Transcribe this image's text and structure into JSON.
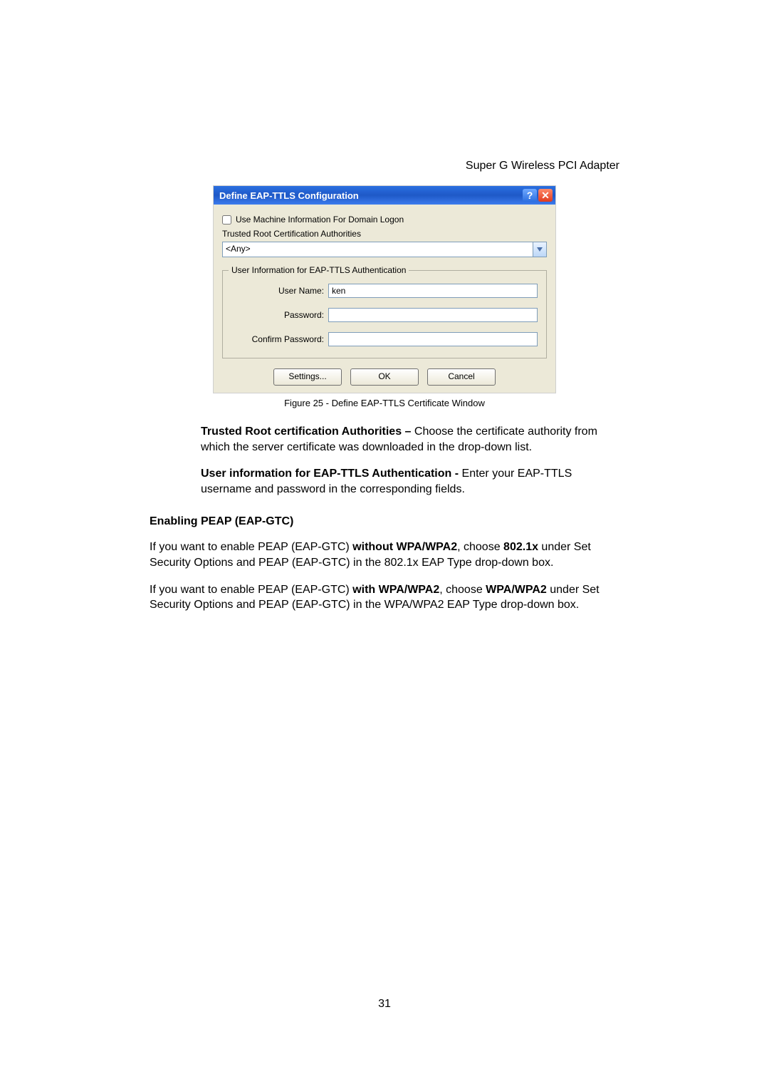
{
  "doc": {
    "header_right": "Super G Wireless PCI Adapter",
    "page_number": "31"
  },
  "dialog": {
    "title": "Define EAP-TTLS Configuration",
    "checkbox_label": "Use Machine Information For Domain Logon",
    "trca_label": "Trusted Root Certification Authorities",
    "trca_value": "<Any>",
    "fieldset_legend": "User Information for EAP-TTLS Authentication",
    "fields": {
      "username_label": "User Name:",
      "username_value": "ken",
      "password_label": "Password:",
      "password_value": "",
      "confirm_label": "Confirm Password:",
      "confirm_value": ""
    },
    "buttons": {
      "settings": "Settings...",
      "ok": "OK",
      "cancel": "Cancel"
    }
  },
  "figure_caption": "Figure 25 - Define EAP-TTLS Certificate Window",
  "paragraphs": {
    "p1_bold": "Trusted Root certification Authorities – ",
    "p1_rest": "Choose the certificate authority from which the server certificate was downloaded in the drop-down list.",
    "p2_bold": "User information for EAP-TTLS Authentication - ",
    "p2_rest": "Enter your EAP-TTLS username and password in the corresponding fields.",
    "section_title": "Enabling PEAP (EAP-GTC)",
    "p3_a": "If you want to enable PEAP (EAP-GTC) ",
    "p3_b_bold": "without WPA/WPA2",
    "p3_c": ", choose ",
    "p3_d_bold": "802.1x",
    "p3_e": " under Set Security Options and PEAP (EAP-GTC) in the 802.1x EAP Type drop-down box.",
    "p4_a": "If you want to enable PEAP (EAP-GTC) ",
    "p4_b_bold": "with WPA/WPA2",
    "p4_c": ", choose ",
    "p4_d_bold": "WPA/WPA2",
    "p4_e": " under Set Security Options and PEAP (EAP-GTC) in the WPA/WPA2 EAP Type drop-down box."
  }
}
